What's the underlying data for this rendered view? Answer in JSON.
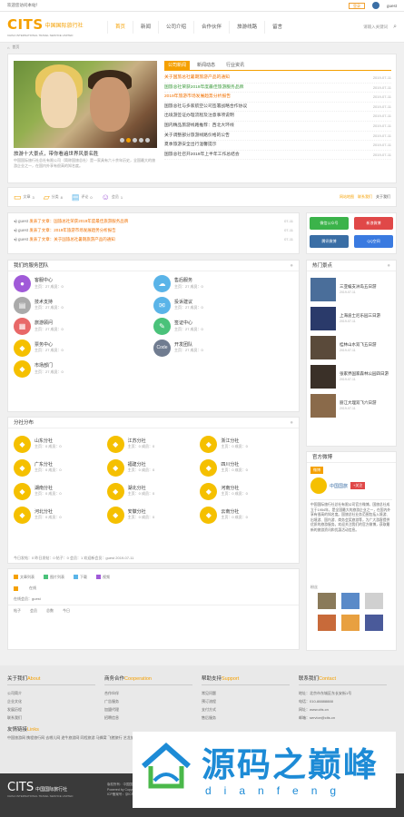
{
  "topbar": {
    "welcome": "欢迎您访问本站！",
    "login": "登录",
    "username": "guest"
  },
  "brand": {
    "logo": "CITS",
    "cn": "中国国际旅行社",
    "sub": "CHINA INTERNATIONAL TRAVEL SERVICE LIMITED"
  },
  "nav": [
    "首页",
    "新闻",
    "公司介绍",
    "合作伙伴",
    "旅游线路",
    "留言"
  ],
  "search": {
    "placeholder": "请输入关键词",
    "icon": "search-icon"
  },
  "breadcrumb": {
    "home": "首页"
  },
  "slider": {
    "title": "旅游十大景点，带你看遍世界风景名胜",
    "desc": "中国国际旅行社总社有限公司（简称国旅总社）是一家具有六十余年历史，全国最大的旅游企业之一，在国内外享有很高的知名度。",
    "dots": 5,
    "active_dot": 1
  },
  "news": {
    "tabs": [
      "公司新闻",
      "新闻动态",
      "行业资讯"
    ],
    "items": [
      {
        "title": "关于国旅总社暑期旅游产品的通知",
        "date": "2019-07-11",
        "style": "orange"
      },
      {
        "title": "国旅总社荣获2019年度最佳旅游服务品牌",
        "date": "2019-07-11",
        "style": "green"
      },
      {
        "title": "2019年旅游市场发展趋势分析报告",
        "date": "2019-07-11",
        "style": "orange"
      },
      {
        "title": "国旅总社与多家航空公司签署战略合作协议",
        "date": "2019-07-11",
        "style": ""
      },
      {
        "title": "出境游签证办理流程及注意事项说明",
        "date": "2019-07-11",
        "style": ""
      },
      {
        "title": "国内精品旅游线路推荐：西北大环线",
        "date": "2019-07-11",
        "style": ""
      },
      {
        "title": "关于调整部分旅游线路价格的公告",
        "date": "2019-07-11",
        "style": ""
      },
      {
        "title": "夏季旅游安全出行温馨提示",
        "date": "2019-07-11",
        "style": ""
      },
      {
        "title": "国旅总社召开2019年上半年工作总结会",
        "date": "2019-07-11",
        "style": ""
      }
    ]
  },
  "stats": [
    {
      "icon": "document-icon",
      "label": "文章",
      "value": "3"
    },
    {
      "icon": "folder-icon",
      "label": "分类",
      "value": "8"
    },
    {
      "icon": "comment-icon",
      "label": "评论",
      "value": "0"
    },
    {
      "icon": "user-icon",
      "label": "会员",
      "value": "1"
    }
  ],
  "stats_links": [
    "网站地图",
    "联系我们",
    "关于我们"
  ],
  "ticker": [
    {
      "user": "guest",
      "text": "发表了文章：国旅总社荣获2019年度最佳旅游服务品牌",
      "date": "07-11"
    },
    {
      "user": "guest",
      "text": "发表了文章：2019年旅游市场发展趋势分析报告",
      "date": "07-11"
    },
    {
      "user": "guest",
      "text": "发表了文章：关于国旅总社暑期旅游产品的通知",
      "date": "07-11"
    }
  ],
  "social": [
    {
      "label": "微信公众号",
      "color": "#3bb34a"
    },
    {
      "label": "新浪微博",
      "color": "#e04848"
    },
    {
      "label": "腾讯微博",
      "color": "#3a6ea5"
    },
    {
      "label": "QQ空间",
      "color": "#3a7ae0"
    }
  ],
  "teams": {
    "title": "我们的服务团队",
    "items": [
      {
        "name": "客服中心",
        "desc": "主页：27 成员：0",
        "icon": "●",
        "color": "#a05ad8"
      },
      {
        "name": "售后服务",
        "desc": "主页：27 成员：0",
        "icon": "☁",
        "color": "#5ab4e8"
      },
      {
        "name": "技术支持",
        "desc": "主页：27 成员：0",
        "icon": "▤",
        "color": "#aaaaaa"
      },
      {
        "name": "投诉建议",
        "desc": "主页：27 成员：0",
        "icon": "✉",
        "color": "#5ab4e8"
      },
      {
        "name": "旅游顾问",
        "desc": "主页：27 成员：0",
        "icon": "▦",
        "color": "#e86868"
      },
      {
        "name": "签证中心",
        "desc": "主页：27 成员：0",
        "icon": "✎",
        "color": "#4ac27a"
      },
      {
        "name": "票务中心",
        "desc": "主页：27 成员：0",
        "icon": "◆",
        "color": "#f5c000"
      },
      {
        "name": "开发团队",
        "desc": "主页：27 成员：0",
        "icon": "Code",
        "color": "#707c90"
      },
      {
        "name": "市场部门",
        "desc": "主页：27 成员：0",
        "icon": "◆",
        "color": "#f5c000"
      }
    ]
  },
  "provinces": {
    "title": "分社分布",
    "items": [
      {
        "name": "山东分社",
        "desc": "主页：0 成员：0"
      },
      {
        "name": "江苏分社",
        "desc": "主页：0 成员：0"
      },
      {
        "name": "浙江分社",
        "desc": "主页：0 成员：0"
      },
      {
        "name": "广东分社",
        "desc": "主页：0 成员：0"
      },
      {
        "name": "福建分社",
        "desc": "主页：0 成员：0"
      },
      {
        "name": "四川分社",
        "desc": "主页：0 成员：0"
      },
      {
        "name": "湖南分社",
        "desc": "主页：0 成员：0"
      },
      {
        "name": "湖北分社",
        "desc": "主页：0 成员：0"
      },
      {
        "name": "河南分社",
        "desc": "主页：0 成员：0"
      },
      {
        "name": "河北分社",
        "desc": "主页：0 成员：0"
      },
      {
        "name": "安徽分社",
        "desc": "主页：0 成员：0"
      },
      {
        "name": "云南分社",
        "desc": "主页：0 成员：0"
      }
    ],
    "footer": "今日发帖：0  昨日发帖：0  帖子：0  会员：1  欢迎新会员：guest  2019-07-11"
  },
  "bottom_info": {
    "row1": [
      {
        "label": "文章列表",
        "color": "#f5a000"
      },
      {
        "label": "图片列表",
        "color": "#4ac27a"
      },
      {
        "label": "下载",
        "color": "#5ab4e8"
      },
      {
        "label": "视频",
        "color": "#a05ad8"
      }
    ],
    "row2_label": "在线",
    "row3": "在线会员：guest",
    "row4": [
      "帖子",
      "会员",
      "总数",
      "今日"
    ]
  },
  "hot": {
    "title": "热门景点",
    "items": [
      {
        "title": "三亚蜈支洲岛五日游",
        "sub": "2019-07-11",
        "color": "#4a6e9a"
      },
      {
        "title": "上海迪士尼乐园三日游",
        "sub": "2019-07-11",
        "color": "#2a3a6a"
      },
      {
        "title": "桂林山水双飞五日游",
        "sub": "2019-07-11",
        "color": "#5a4a3a"
      },
      {
        "title": "张家界国家森林公园四日游",
        "sub": "2019-07-11",
        "color": "#3a3028"
      },
      {
        "title": "丽江大理双飞六日游",
        "sub": "2019-07-11",
        "color": "#8a6a4a"
      }
    ]
  },
  "weibo": {
    "title": "官方微博",
    "tab": "微博",
    "name": "中国国旅",
    "follow": "+关注",
    "text": "中国国际旅行社总社有限公司官方微博。国旅总社成立于1954年，是全国最大的旅游企业之一，在国内外享有很高的知名度。国旅总社业务范围包括入境游、出境游、国内游、商务会奖旅游等，为广大游客提供优质的旅游服务。欢迎关注我们的官方微博，获取最新的旅游资讯和优惠活动信息。",
    "fans_label": "粉丝",
    "fans": [
      "#8a7a5a",
      "#5a8ac8",
      "#d0d0d0",
      "#c86a3a",
      "#e8a040",
      "#4a5a9a"
    ]
  },
  "footer": {
    "cols": [
      {
        "head": "关于我们",
        "head_en": "About",
        "items": [
          "公司简介",
          "企业文化",
          "发展历程",
          "联系我们"
        ]
      },
      {
        "head": "商务合作",
        "head_en": "Cooperation",
        "items": [
          "合作伙伴",
          "广告服务",
          "加盟代理",
          "招聘信息"
        ]
      },
      {
        "head": "帮助支持",
        "head_en": "Support",
        "items": [
          "常见问题",
          "预订流程",
          "支付方式",
          "售后服务"
        ]
      },
      {
        "head": "联系我们",
        "head_en": "Contact",
        "items": [
          "地址：北京市东城区东长安街1号",
          "电话：010-88888888",
          "网址：www.cits.cn",
          "邮箱：service@cits.cn"
        ]
      }
    ],
    "links_head": "友情链接",
    "links_head_en": "Links",
    "links": "中国旅游网  携程旅行网  去哪儿网  途牛旅游网  同程旅游  马蜂窝  飞猪旅行  艺龙旅行网",
    "copy_lines": [
      "版权所有：中国国际旅行社总社有限公司",
      "Powered by  Copyright © 2019",
      "ICP备案号：京ICP备00000000号"
    ]
  },
  "watermark": {
    "title": "源码之巅峰",
    "pinyin": "dianfeng"
  }
}
